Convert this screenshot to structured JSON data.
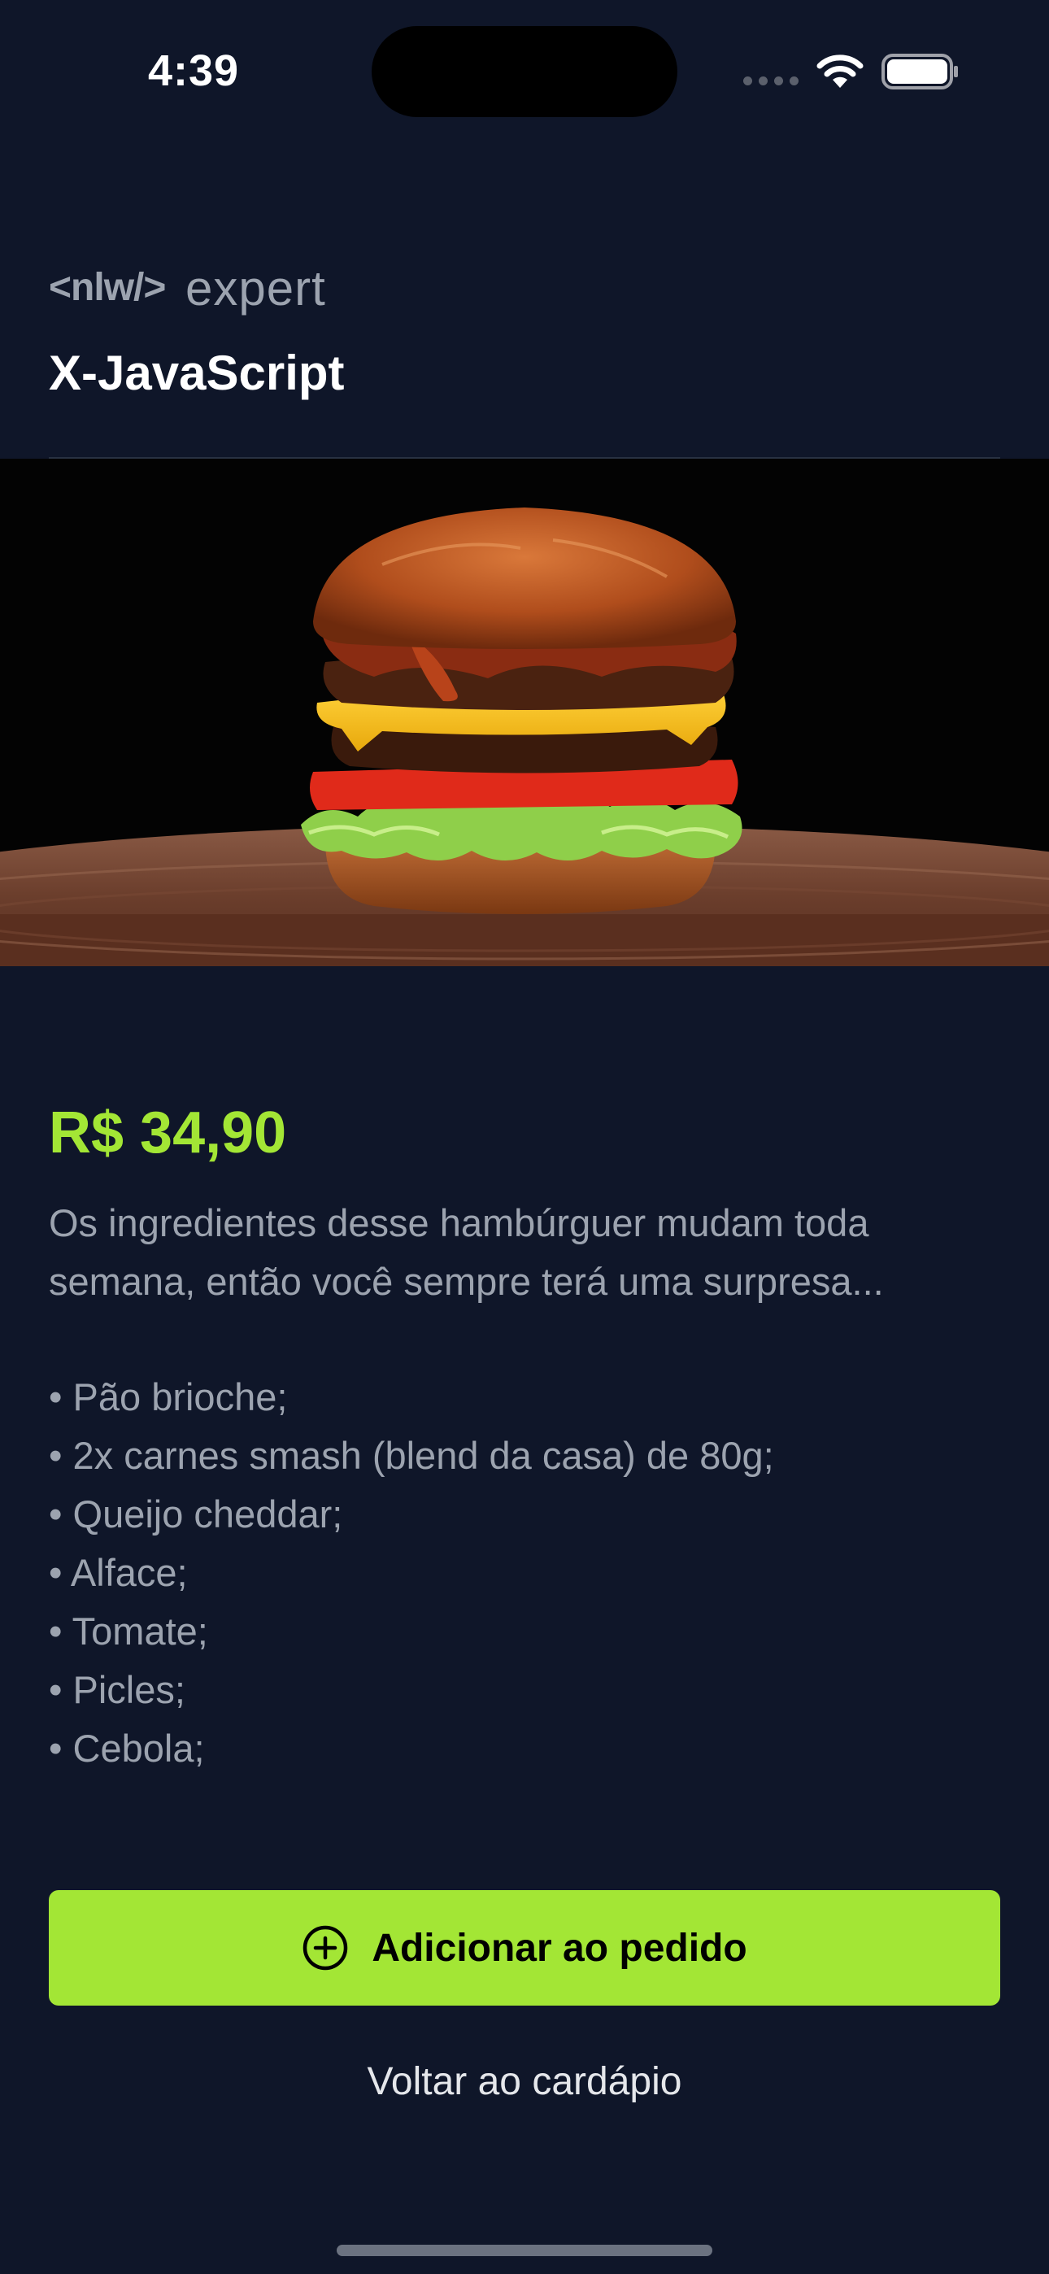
{
  "status_bar": {
    "time": "4:39",
    "icons": [
      "cellular-signal-icon",
      "wifi-icon",
      "battery-icon"
    ]
  },
  "header": {
    "logo_text_nlw": "<nlw/>",
    "logo_text_expert": "expert",
    "title": "X-JavaScript"
  },
  "product": {
    "image": "burger-photo",
    "price": "R$ 34,90",
    "description": "Os ingredientes desse hambúrguer mudam toda semana, então você sempre terá uma surpresa...",
    "ingredients": [
      "• Pão brioche;",
      "• 2x carnes smash (blend da casa) de 80g;",
      "• Queijo cheddar;",
      "• Alface;",
      "• Tomate;",
      "• Picles;",
      "• Cebola;"
    ]
  },
  "actions": {
    "add_label": "Adicionar ao pedido",
    "add_icon": "plus-circle-icon",
    "back_label": "Voltar ao cardápio"
  },
  "colors": {
    "background": "#0f1629",
    "accent": "#a3e635",
    "text_muted": "#9ca3af",
    "divider": "#283142"
  }
}
